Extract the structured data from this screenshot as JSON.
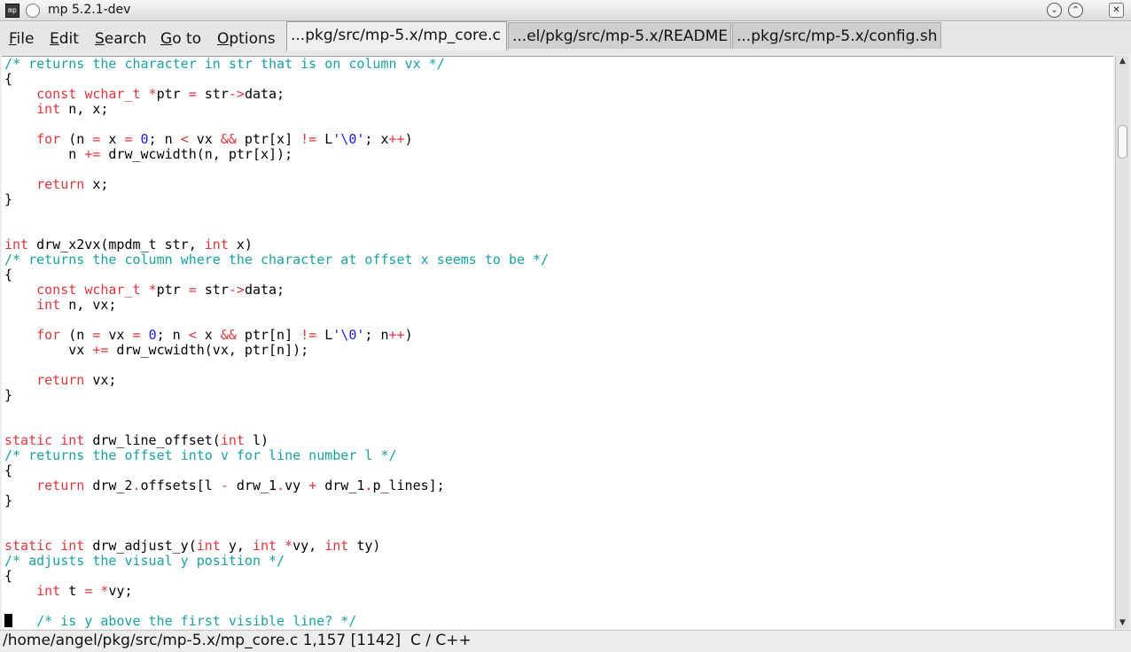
{
  "window": {
    "title": "mp 5.2.1-dev",
    "app_icon": "mp-app-icon",
    "controls": [
      "minimize-icon",
      "maximize-icon",
      "close-icon"
    ]
  },
  "menu": {
    "items": [
      {
        "label": "File",
        "accelerator": "F"
      },
      {
        "label": "Edit",
        "accelerator": "E"
      },
      {
        "label": "Search",
        "accelerator": "S"
      },
      {
        "label": "Go to",
        "accelerator": "G"
      },
      {
        "label": "Options",
        "accelerator": "O"
      }
    ]
  },
  "tabs": [
    {
      "label": "...pkg/src/mp-5.x/mp_core.c",
      "active": true
    },
    {
      "label": "...el/pkg/src/mp-5.x/README",
      "active": false
    },
    {
      "label": "...pkg/src/mp-5.x/config.sh",
      "active": false
    }
  ],
  "editor": {
    "lines": [
      "/* returns the character in str that is on column vx */",
      "{",
      "    const wchar_t *ptr = str->data;",
      "    int n, x;",
      "",
      "    for (n = x = 0; n < vx && ptr[x] != L'\\0'; x++)",
      "        n += drw_wcwidth(n, ptr[x]);",
      "",
      "    return x;",
      "}",
      "",
      "",
      "int drw_x2vx(mpdm_t str, int x)",
      "/* returns the column where the character at offset x seems to be */",
      "{",
      "    const wchar_t *ptr = str->data;",
      "    int n, vx;",
      "",
      "    for (n = vx = 0; n < x && ptr[n] != L'\\0'; n++)",
      "        vx += drw_wcwidth(vx, ptr[n]);",
      "",
      "    return vx;",
      "}",
      "",
      "",
      "static int drw_line_offset(int l)",
      "/* returns the offset into v for line number l */",
      "{",
      "    return drw_2.offsets[l - drw_1.vy + drw_1.p_lines];",
      "}",
      "",
      "",
      "static int drw_adjust_y(int y, int *vy, int ty)",
      "/* adjusts the visual y position */",
      "{",
      "    int t = *vy;",
      "",
      "    /* is y above the first visible line? */"
    ],
    "colors": {
      "keyword": "#e0363d",
      "comment": "#1aa0a0",
      "number": "#1a1ad8",
      "text": "#000000",
      "background": "#ffffff"
    }
  },
  "status": {
    "text": "/home/angel/pkg/src/mp-5.x/mp_core.c 1,157 [1142]  C / C++"
  }
}
